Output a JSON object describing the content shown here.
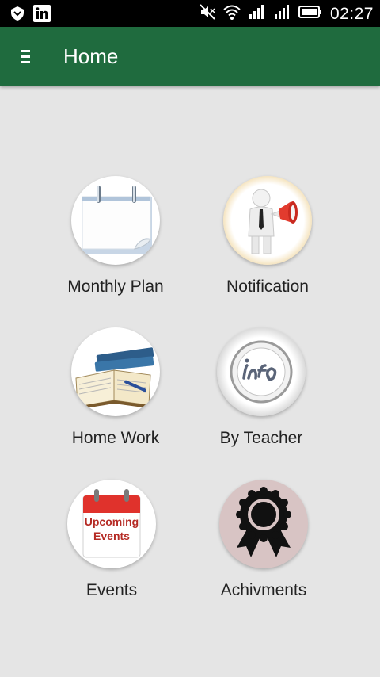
{
  "status_bar": {
    "time": "02:27",
    "icons": [
      "notification-shield-icon",
      "linkedin-icon",
      "mute-icon",
      "wifi-icon",
      "signal-icon",
      "signal-icon",
      "battery-icon"
    ]
  },
  "app_bar": {
    "title": "Home",
    "menu_icon": "hamburger-menu-icon",
    "color": "#1f6b3e"
  },
  "tiles": [
    {
      "label": "Monthly Plan",
      "icon": "calendar-icon"
    },
    {
      "label": "Notification",
      "icon": "megaphone-person-icon"
    },
    {
      "label": "Home Work",
      "icon": "notebook-books-icon"
    },
    {
      "label": "By Teacher",
      "icon": "info-icon"
    },
    {
      "label": "Events",
      "icon": "upcoming-events-calendar-icon",
      "icon_text": [
        "Upcoming",
        "Events"
      ]
    },
    {
      "label": "Achivments",
      "icon": "award-ribbon-icon"
    }
  ]
}
